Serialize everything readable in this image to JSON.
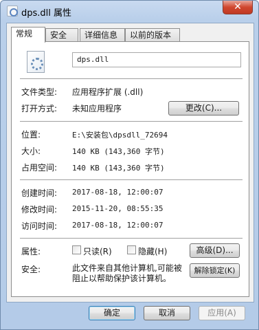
{
  "window": {
    "title": "dps.dll 属性",
    "close_glyph": "✕"
  },
  "tabs": [
    {
      "label": "常规"
    },
    {
      "label": "安全"
    },
    {
      "label": "详细信息"
    },
    {
      "label": "以前的版本"
    }
  ],
  "general": {
    "file_name": "dps.dll",
    "file_type_label": "文件类型:",
    "file_type_value": "应用程序扩展 (.dll)",
    "opens_with_label": "打开方式:",
    "opens_with_value": "未知应用程序",
    "change_button": "更改(C)...",
    "location_label": "位置:",
    "location_value": "E:\\安装包\\dpsdll_72694",
    "size_label": "大小:",
    "size_value": "140 KB (143,360 字节)",
    "size_on_disk_label": "占用空间:",
    "size_on_disk_value": "140 KB (143,360 字节)",
    "created_label": "创建时间:",
    "created_value": "2017-08-18, 12:00:07",
    "modified_label": "修改时间:",
    "modified_value": "2015-11-20, 08:55:35",
    "accessed_label": "访问时间:",
    "accessed_value": "2017-08-18, 12:00:07",
    "attributes_label": "属性:",
    "readonly_label": "只读(R)",
    "hidden_label": "隐藏(H)",
    "advanced_button": "高级(D)...",
    "security_label": "安全:",
    "security_text": "此文件来自其他计算机,可能被阻止以帮助保护该计算机。",
    "unblock_button": "解除锁定(K)"
  },
  "footer": {
    "ok_button": "确定",
    "cancel_button": "取消",
    "apply_button": "应用(A)"
  },
  "icons": {
    "title_icon": "dll-file-icon",
    "file_icon": "dll-file-icon",
    "close_icon": "close-icon"
  },
  "colors": {
    "titlebar": "#c9daf0",
    "close_button": "#d0472f",
    "panel": "#f0f0f0"
  }
}
